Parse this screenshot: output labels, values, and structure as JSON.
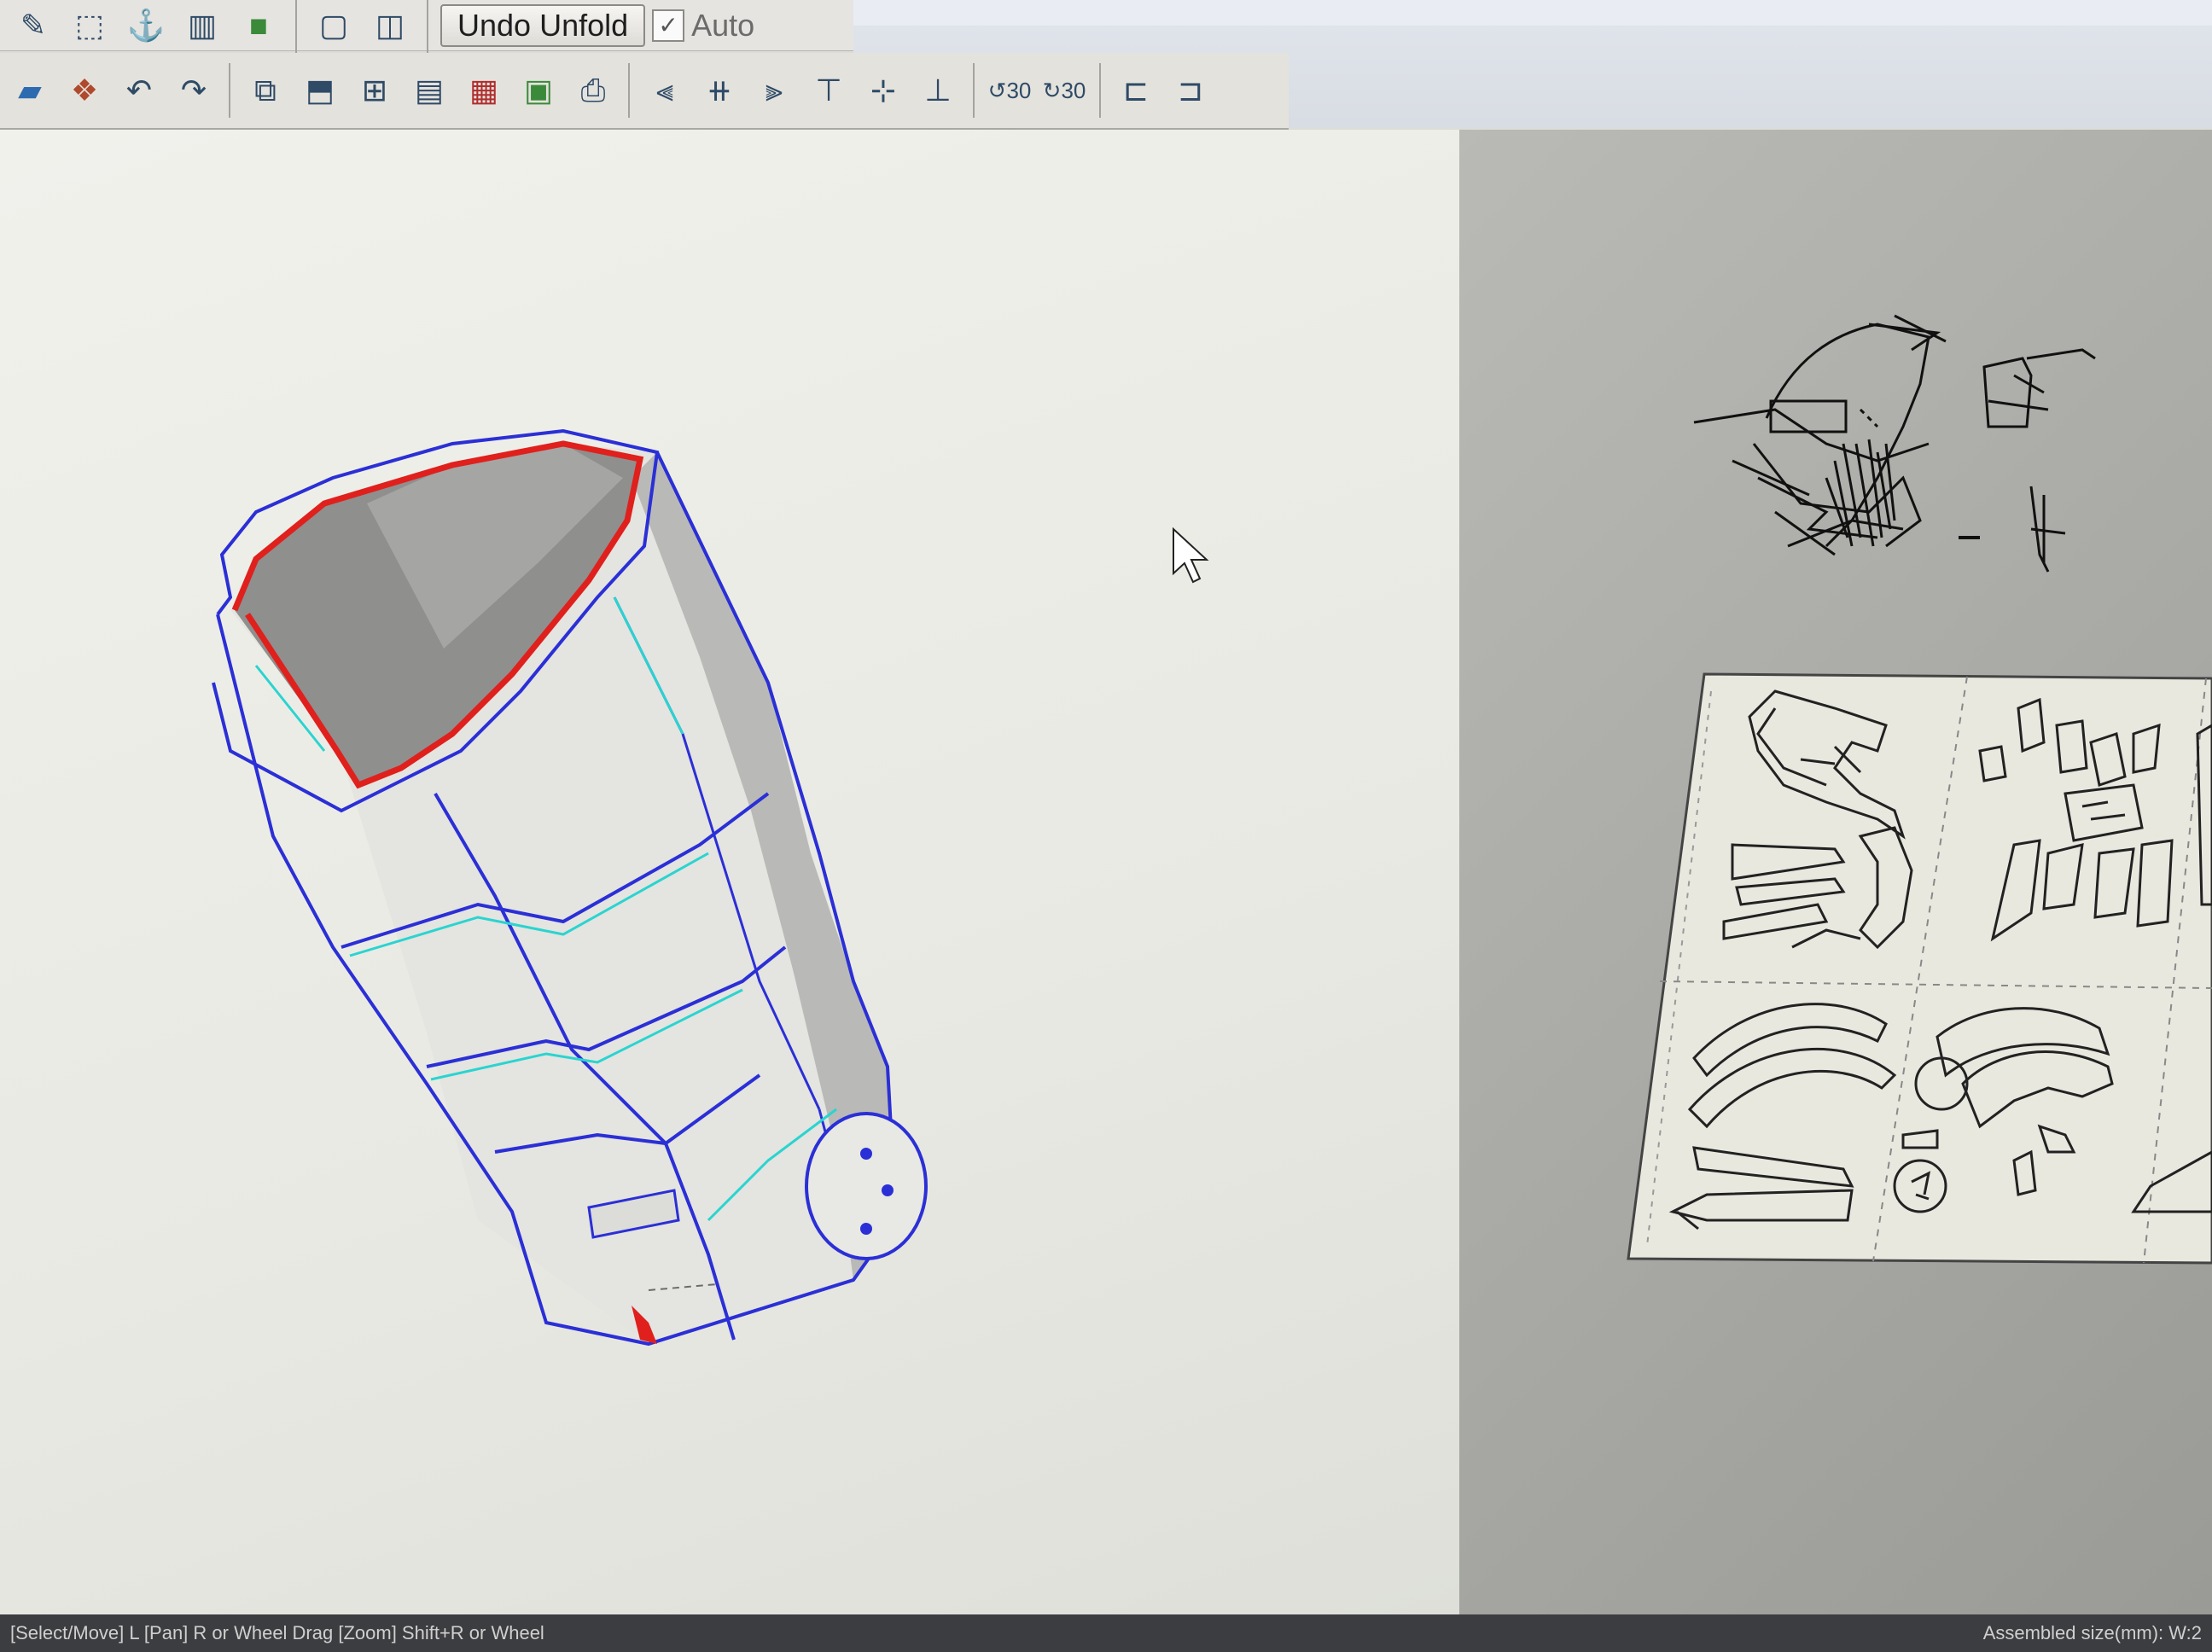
{
  "toolbar": {
    "row1_icons": [
      "pencil-icon",
      "cube-icon",
      "anchor-icon",
      "columns-icon",
      "green-cube-icon",
      "window-single-icon",
      "window-split-icon"
    ],
    "undo_unfold_label": "Undo Unfold",
    "auto_label": "Auto",
    "auto_checked": true,
    "row2_icons": [
      "open-file-icon",
      "add-model-icon",
      "undo-icon",
      "redo-icon",
      "unfold-icon",
      "select-part-icon",
      "arrange-icon",
      "page-setup-icon",
      "print-color-icon",
      "preview-icon",
      "printer-icon",
      "align-left-icon",
      "align-center-icon",
      "align-right-icon",
      "align-top-icon",
      "align-middle-icon",
      "align-bottom-icon",
      "rotate-left-30-icon",
      "rotate-right-30-icon",
      "distribute-h-icon",
      "distribute-v-icon"
    ],
    "rotate_left_label": "30",
    "rotate_right_label": "30"
  },
  "colors": {
    "edge_blue": "#2b2fd6",
    "fold_cyan": "#2ad4d0",
    "selected_red": "#e0201c"
  },
  "status": {
    "left_hint": "[Select/Move] L [Pan] R or Wheel Drag [Zoom] Shift+R or Wheel",
    "right_hint": "Assembled size(mm): W:2"
  }
}
